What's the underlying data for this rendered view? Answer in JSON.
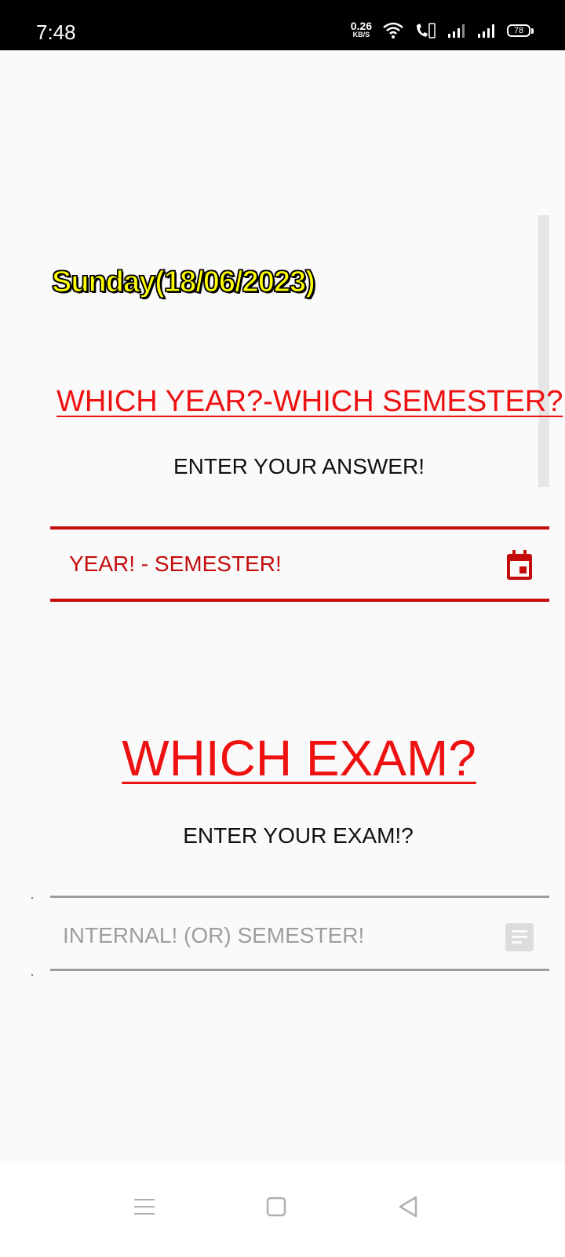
{
  "status_bar": {
    "time": "7:48",
    "net_speed_value": "0.26",
    "net_speed_unit": "KB/S",
    "battery": "78"
  },
  "main": {
    "date": "Sunday(18/06/2023)",
    "question_year": "WHICH YEAR?-WHICH SEMESTER?",
    "prompt_answer": "ENTER YOUR ANSWER!",
    "year_field_value": "YEAR! - SEMESTER!",
    "question_exam": "WHICH EXAM?",
    "prompt_exam": "ENTER YOUR EXAM!?",
    "exam_field_placeholder": "INTERNAL! (OR) SEMESTER!"
  },
  "icons": {
    "year_field": "calendar-icon",
    "exam_field": "notes-icon",
    "nav_menu": "menu-icon",
    "nav_home": "home-icon",
    "nav_back": "back-icon"
  },
  "colors": {
    "accent_red": "#ee1111",
    "field_red": "#c40c0c",
    "date_yellow": "#ffff00",
    "disabled_gray": "#9e9e9e"
  }
}
